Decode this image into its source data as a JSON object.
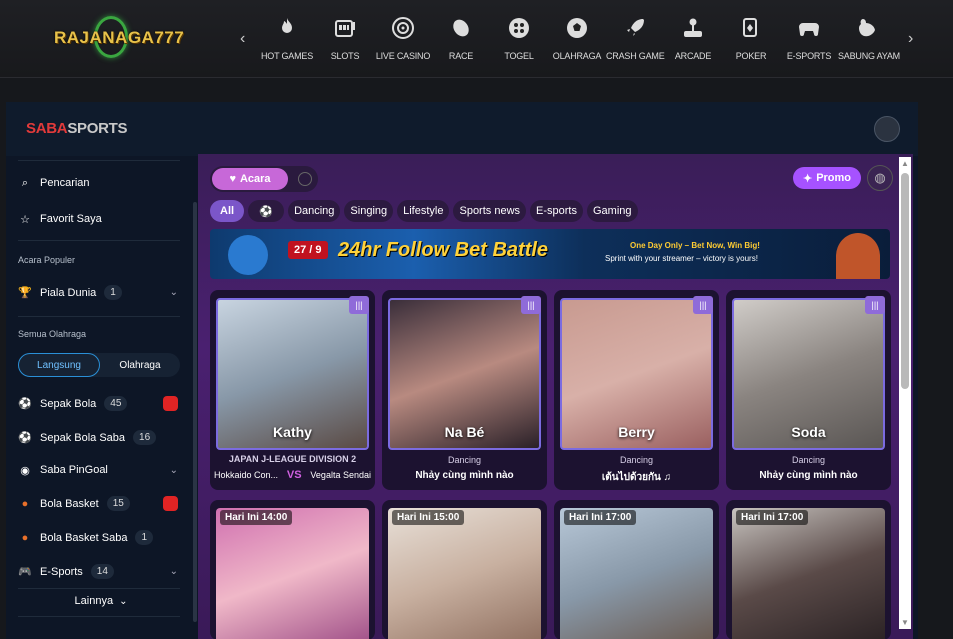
{
  "site": {
    "logo_text": "RAJANAGA777"
  },
  "topnav": {
    "items": [
      {
        "label": "HOT GAMES",
        "icon": "flame-icon"
      },
      {
        "label": "SLOTS",
        "icon": "slot-machine-icon"
      },
      {
        "label": "LIVE CASINO",
        "icon": "roulette-icon"
      },
      {
        "label": "RACE",
        "icon": "race-icon"
      },
      {
        "label": "TOGEL",
        "icon": "balls-icon"
      },
      {
        "label": "OLAHRAGA",
        "icon": "soccer-ball-icon"
      },
      {
        "label": "CRASH GAME",
        "icon": "rocket-icon"
      },
      {
        "label": "ARCADE",
        "icon": "joystick-icon"
      },
      {
        "label": "POKER",
        "icon": "cards-icon"
      },
      {
        "label": "E-SPORTS",
        "icon": "gamepad-icon"
      },
      {
        "label": "SABUNG AYAM",
        "icon": "rooster-icon"
      }
    ]
  },
  "frame": {
    "brand_part1": "SABA",
    "brand_part2": "SPORTS"
  },
  "sidebar": {
    "search": "Pencarian",
    "favorite": "Favorit Saya",
    "popular_header": "Acara Populer",
    "popular_item": {
      "label": "Piala Dunia",
      "count": "1"
    },
    "all_sports_header": "Semua Olahraga",
    "toggle": {
      "live": "Langsung",
      "sports": "Olahraga"
    },
    "sports": [
      {
        "label": "Sepak Bola",
        "count": "45"
      },
      {
        "label": "Sepak Bola Saba",
        "count": "16"
      },
      {
        "label": "Saba PinGoal",
        "count": ""
      },
      {
        "label": "Bola Basket",
        "count": "15"
      },
      {
        "label": "Bola Basket Saba",
        "count": "1"
      },
      {
        "label": "E-Sports",
        "count": "14"
      }
    ],
    "more": "Lainnya"
  },
  "main": {
    "acara": "Acara",
    "promo": "Promo",
    "chips": [
      "All",
      "Dancing",
      "Singing",
      "Lifestyle",
      "Sports news",
      "E-sports",
      "Gaming"
    ],
    "banner": {
      "date": "27 / 9",
      "title": "24hr Follow Bet Battle",
      "line1": "One Day Only – Bet Now, Win Big!",
      "line2": "Sprint with your streamer – victory is yours!"
    },
    "cards": [
      {
        "name": "Kathy",
        "league": "JAPAN J-LEAGUE DIVISION 2",
        "home": "Hokkaido Con...",
        "vs": "VS",
        "away": "Vegalta Sendai"
      },
      {
        "name": "Na Bé",
        "category": "Dancing",
        "song": "Nhảy cùng mình nào"
      },
      {
        "name": "Berry",
        "category": "Dancing",
        "song": "เต้นไปด้วยกัน ♫"
      },
      {
        "name": "Soda",
        "category": "Dancing",
        "song": "Nhảy cùng mình nào"
      }
    ],
    "upcoming": [
      {
        "time": "Hari Ini 14:00"
      },
      {
        "time": "Hari Ini 15:00"
      },
      {
        "time": "Hari Ini 17:00"
      },
      {
        "time": "Hari Ini 17:00"
      }
    ]
  }
}
